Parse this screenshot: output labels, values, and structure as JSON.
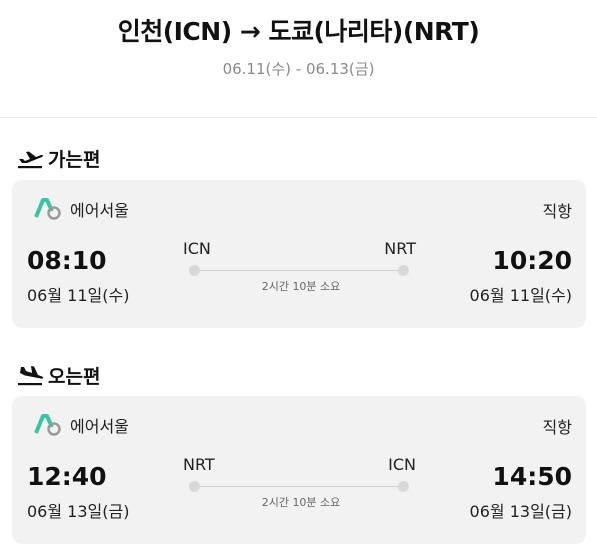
{
  "header": {
    "route": "인천(ICN) → 도쿄(나리타)(NRT)",
    "dates": "06.11(수) - 06.13(금)"
  },
  "legs": [
    {
      "heading": "가는편",
      "icon": "departure-plane-icon",
      "airline": "에어서울",
      "type": "직항",
      "dep_time": "08:10",
      "dep_date": "06월 11일(수)",
      "from": "ICN",
      "to": "NRT",
      "duration": "2시간 10분 소요",
      "arr_time": "10:20",
      "arr_date": "06월 11일(수)"
    },
    {
      "heading": "오는편",
      "icon": "arrival-plane-icon",
      "airline": "에어서울",
      "type": "직항",
      "dep_time": "12:40",
      "dep_date": "06월 13일(금)",
      "from": "NRT",
      "to": "ICN",
      "duration": "2시간 10분 소요",
      "arr_time": "14:50",
      "arr_date": "06월 13일(금)"
    }
  ],
  "colors": {
    "brand_logo": "#3cc3a5",
    "card_bg": "#f2f2f2",
    "muted_text": "#8a8a8a"
  }
}
